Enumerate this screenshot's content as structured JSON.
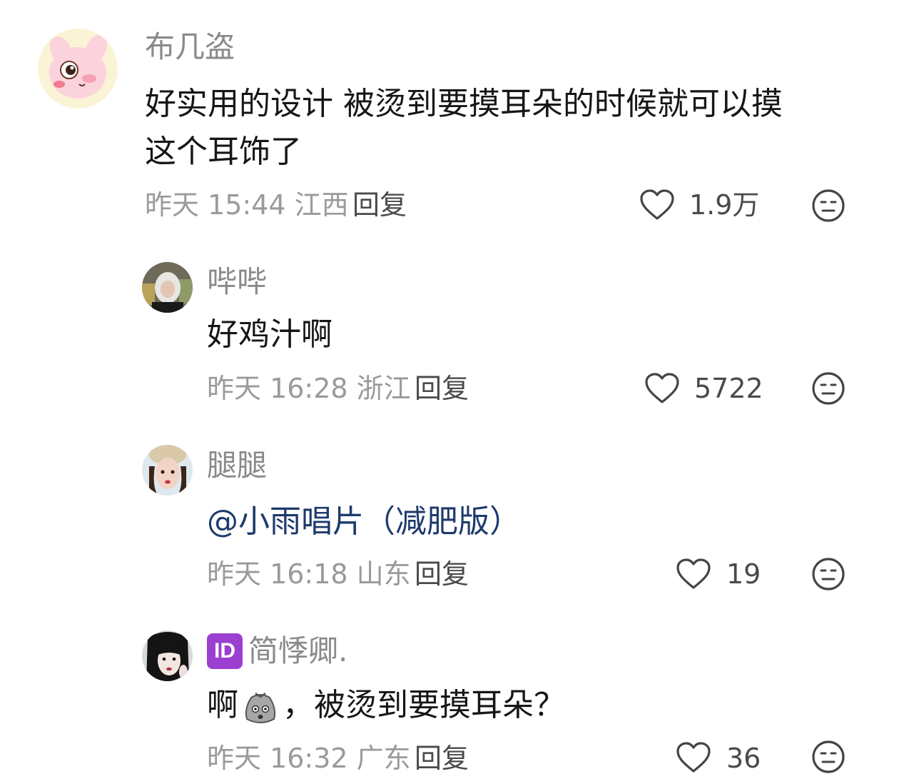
{
  "comments": [
    {
      "username": "布几盗",
      "text_line1": "好实用的设计 被烫到要摸耳朵的时候就可以摸",
      "text_line2": "这个耳饰了",
      "meta": "昨天 15:44 江西",
      "reply_label": "回复",
      "likes": "1.9万"
    },
    {
      "username": "哔哔",
      "text": "好鸡汁啊",
      "meta": "昨天 16:28 浙江",
      "reply_label": "回复",
      "likes": "5722"
    },
    {
      "username": "腿腿",
      "text": "@小雨唱片（减肥版）",
      "meta": "昨天 16:18 山东",
      "reply_label": "回复",
      "likes": "19"
    },
    {
      "username": "简悸卿.",
      "badge": "ID",
      "text_before": "啊",
      "text_after": "，被烫到要摸耳朵？",
      "meta": "昨天 16:32 广东",
      "reply_label": "回复",
      "likes": "36"
    }
  ],
  "icons": {
    "like": "heart-outline-icon",
    "emoji_reaction": "neutral-face-icon",
    "inline_emoji": "shocked-bag-face-emoji"
  },
  "colors": {
    "username": "#8a8a8a",
    "text": "#161616",
    "mention": "#1d3a6b",
    "meta": "#9a9a9a",
    "id_badge": "#9b3fd0"
  }
}
